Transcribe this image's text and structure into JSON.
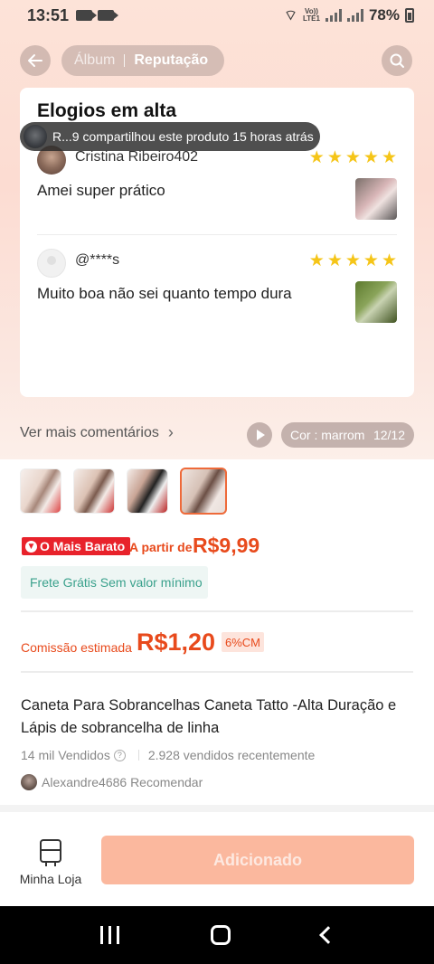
{
  "status_bar": {
    "time": "13:51",
    "lte_label_top": "Vo))",
    "lte_label_bottom": "LTE1",
    "battery": "78%"
  },
  "header": {
    "tabs": [
      {
        "label": "Álbum",
        "active": false
      },
      {
        "label": "Reputação",
        "active": true
      }
    ]
  },
  "reviews_section": {
    "title": "Elogios em alta",
    "reviews": [
      {
        "reviewer": "Cristina Ribeiro402",
        "rating": 5,
        "text": "Amei super prático"
      },
      {
        "reviewer": "@****s",
        "rating": 5,
        "text": "Muito boa não sei quanto tempo dura"
      }
    ],
    "see_more": "Ver mais comentários"
  },
  "share_toast": {
    "text": "R...9 compartilhou este produto 15 horas atrás"
  },
  "media": {
    "color_label": "Cor : marrom",
    "counter": "12/12"
  },
  "pricing": {
    "cheapest_badge": "O Mais Barato",
    "from_label": "A partir de",
    "price": "R$9,99",
    "free_shipping": "Frete Grátis Sem valor mínimo"
  },
  "commission": {
    "label": "Comissão estimada",
    "value": "R$1,20",
    "badge": "6%CM"
  },
  "product": {
    "title": "Caneta Para Sobrancelhas Caneta Tatto -Alta Duração e Lápis de sobrancelha de linha",
    "sold": "14 mil Vendidos",
    "recent_sold": "2.928 vendidos recentemente",
    "recommender": "Alexandre4686 Recomendar"
  },
  "bottom_bar": {
    "store_label": "Minha Loja",
    "action_label": "Adicionado"
  },
  "colors": {
    "accent": "#e84a1c",
    "badge_red": "#e8222b",
    "star": "#f5c518",
    "free_ship_text": "#3aa18c",
    "button_disabled": "#fbb89e"
  }
}
